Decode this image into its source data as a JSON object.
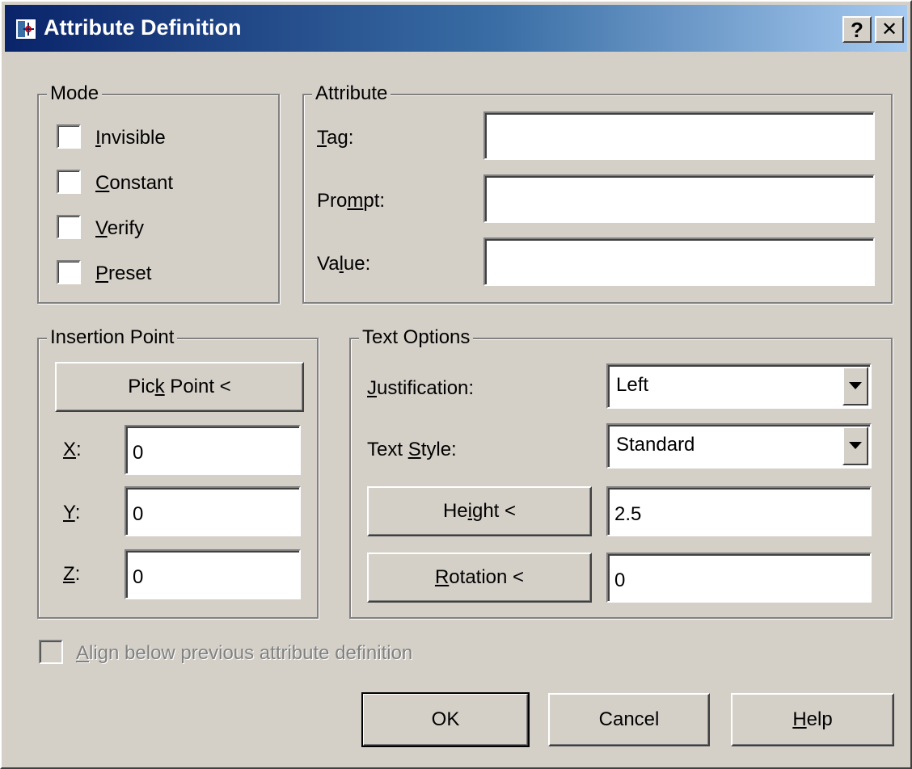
{
  "window": {
    "title": "Attribute Definition",
    "help_button": "?",
    "close_button": "✕"
  },
  "mode": {
    "title": "Mode",
    "items": [
      {
        "pre": "",
        "key": "I",
        "post": "nvisible",
        "checked": false
      },
      {
        "pre": "",
        "key": "C",
        "post": "onstant",
        "checked": false
      },
      {
        "pre": "",
        "key": "V",
        "post": "erify",
        "checked": false
      },
      {
        "pre": "",
        "key": "P",
        "post": "reset",
        "checked": false
      }
    ]
  },
  "attribute": {
    "title": "Attribute",
    "tag": {
      "pre": "",
      "key": "T",
      "post": "ag:",
      "value": ""
    },
    "prompt": {
      "pre": "Pro",
      "key": "m",
      "post": "pt:",
      "value": ""
    },
    "value": {
      "pre": "Va",
      "key": "l",
      "post": "ue:",
      "value": ""
    }
  },
  "insertion_point": {
    "title": "Insertion Point",
    "pick_point": {
      "pre": "Pic",
      "key": "k",
      "post": " Point <"
    },
    "x": {
      "key": "X",
      "post": ":",
      "value": "0"
    },
    "y": {
      "key": "Y",
      "post": ":",
      "value": "0"
    },
    "z": {
      "key": "Z",
      "post": ":",
      "value": "0"
    }
  },
  "text_options": {
    "title": "Text Options",
    "justification": {
      "pre": "",
      "key": "J",
      "post": "ustification:",
      "value": "Left"
    },
    "text_style": {
      "pre": "Text ",
      "key": "S",
      "post": "tyle:",
      "value": "Standard"
    },
    "height": {
      "pre": "He",
      "key": "i",
      "post": "ght <",
      "value": "2.5"
    },
    "rotation": {
      "pre": "",
      "key": "R",
      "post": "otation <",
      "value": "0"
    }
  },
  "align_below": {
    "pre": "",
    "key": "A",
    "post": "lign below previous attribute definition",
    "checked": false,
    "enabled": false
  },
  "buttons": {
    "ok": "OK",
    "cancel": "Cancel",
    "help": {
      "key": "H",
      "post": "elp"
    }
  },
  "colors": {
    "face": "#d4d0c8",
    "title_start": "#0a246a",
    "title_end": "#a6caf0"
  }
}
